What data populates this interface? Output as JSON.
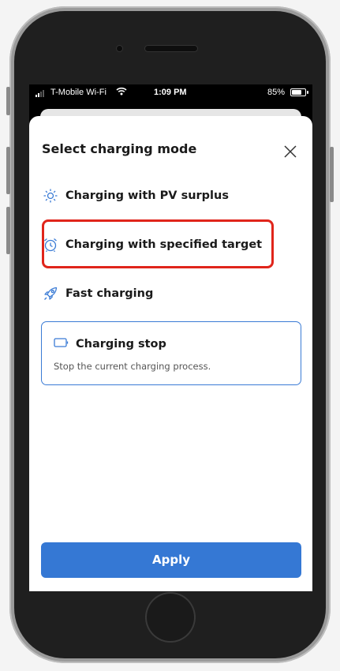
{
  "status_bar": {
    "carrier": "T-Mobile Wi-Fi",
    "time": "1:09 PM",
    "battery_percent": "85%",
    "battery_level": 0.85,
    "signal_bars": 2
  },
  "modal": {
    "title": "Select charging mode",
    "close_icon": "close-icon",
    "options": [
      {
        "label": "Charging with PV surplus",
        "icon": "sun-icon"
      },
      {
        "label": "Charging with specified target",
        "icon": "alarm-clock-icon",
        "highlighted": true
      },
      {
        "label": "Fast charging",
        "icon": "rocket-icon"
      },
      {
        "label": "Charging stop",
        "icon": "battery-icon",
        "description": "Stop the current charging process.",
        "selected": true
      }
    ],
    "apply_label": "Apply"
  },
  "colors": {
    "accent": "#3578d4",
    "highlight": "#e0251b",
    "icon": "#3a7bd5"
  }
}
